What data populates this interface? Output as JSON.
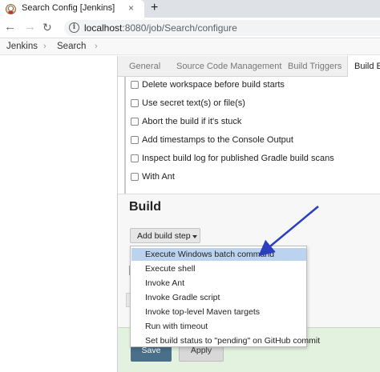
{
  "browser": {
    "tab_title": "Search Config [Jenkins]",
    "close_symbol": "×",
    "newtab_symbol": "+",
    "url_host": "localhost",
    "url_rest": ":8080/job/Search/configure",
    "icons": [
      "jenkins-favicon-icon",
      "back-arrow-icon",
      "forward-arrow-icon",
      "reload-icon",
      "info-icon"
    ]
  },
  "breadcrumbs": {
    "items": [
      "Jenkins",
      "Search"
    ],
    "separator": "›"
  },
  "config_tabs": [
    "General",
    "Source Code Management",
    "Build Triggers",
    "Build E"
  ],
  "build_environment_options": [
    "Delete workspace before build starts",
    "Use secret text(s) or file(s)",
    "Abort the build if it's stuck",
    "Add timestamps to the Console Output",
    "Inspect build log for published Gradle build scans",
    "With Ant"
  ],
  "build": {
    "heading": "Build",
    "add_step_label": "Add build step"
  },
  "menu": {
    "highlighted_index": 0,
    "items": [
      "Execute Windows batch command",
      "Execute shell",
      "Invoke Ant",
      "Invoke Gradle script",
      "Invoke top-level Maven targets",
      "Run with timeout",
      "Set build status to \"pending\" on GitHub commit"
    ]
  },
  "footer": {
    "save_label": "Save",
    "apply_label": "Apply"
  },
  "colors": {
    "highlight": "#bcd3ef",
    "save_button": "#4a6f8a",
    "annotation_arrow": "#2b3fbf",
    "footer_bar": "#e3f1df"
  }
}
